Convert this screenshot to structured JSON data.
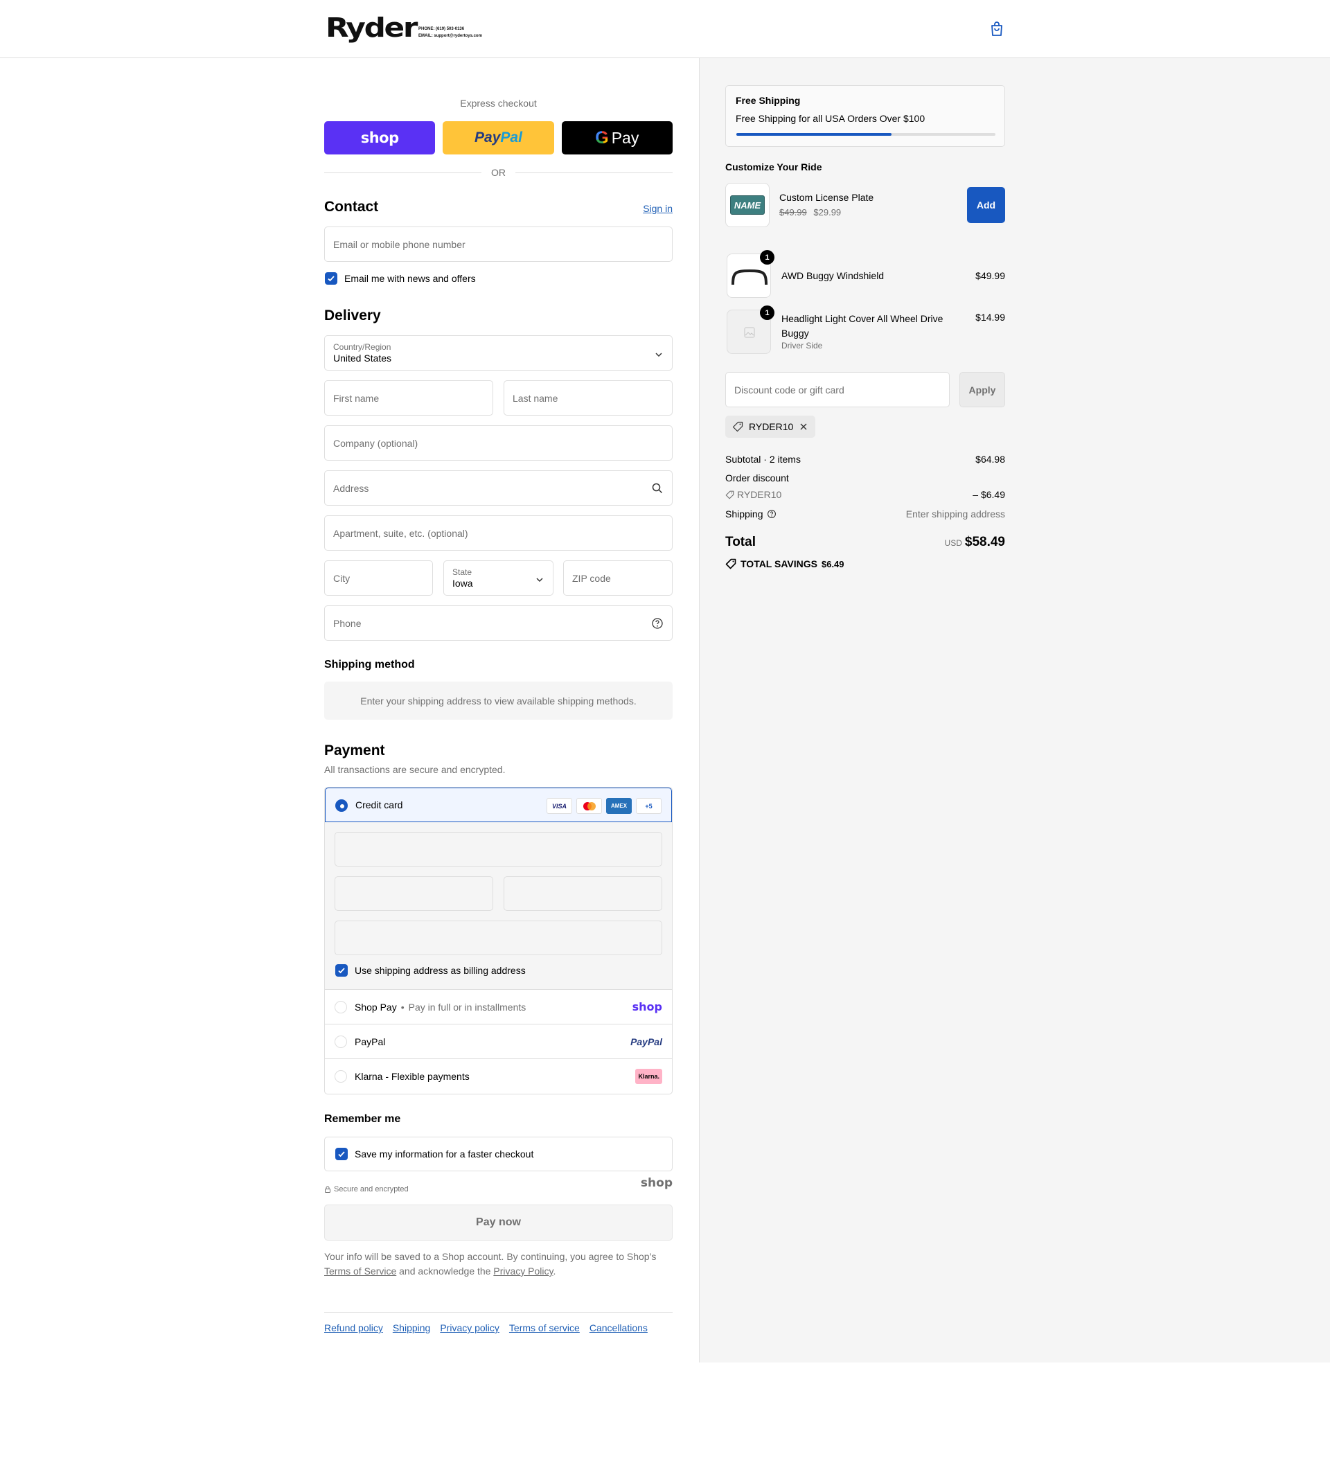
{
  "header": {
    "logo_text": "Ryder",
    "phone": "PHONE: (619) 503-0136",
    "email": "EMAIL: support@rydertoys.com",
    "cart_icon": "shopping-bag-icon"
  },
  "express": {
    "label": "Express checkout",
    "shop": "shop",
    "paypal_a": "Pay",
    "paypal_b": "Pal",
    "gpay_g": "G",
    "gpay_text": "Pay",
    "or": "OR"
  },
  "contact": {
    "title": "Contact",
    "sign_in": "Sign in",
    "email_placeholder": "Email or mobile phone number",
    "news_label": "Email me with news and offers"
  },
  "delivery": {
    "title": "Delivery",
    "country_label": "Country/Region",
    "country_value": "United States",
    "first_name": "First name",
    "last_name": "Last name",
    "company": "Company (optional)",
    "address": "Address",
    "apartment": "Apartment, suite, etc. (optional)",
    "city": "City",
    "state_label": "State",
    "state_value": "Iowa",
    "zip": "ZIP code",
    "phone": "Phone"
  },
  "shipping_method": {
    "title": "Shipping method",
    "message": "Enter your shipping address to view available shipping methods."
  },
  "payment": {
    "title": "Payment",
    "subtitle": "All transactions are secure and encrypted.",
    "credit_card": "Credit card",
    "card_logos": [
      "VISA",
      "",
      "AMEX",
      "+5"
    ],
    "billing_label": "Use shipping address as billing address",
    "shop_pay": "Shop Pay",
    "shop_pay_desc": "Pay in full or in installments",
    "shop_logo": "shop",
    "paypal": "PayPal",
    "paypal_logo": "PayPal",
    "klarna": "Klarna - Flexible payments",
    "klarna_logo": "Klarna."
  },
  "remember": {
    "title": "Remember me",
    "save_label": "Save my information for a faster checkout",
    "secure": "Secure and encrypted",
    "shop_logo": "shop"
  },
  "pay_now": "Pay now",
  "fine_print": {
    "pre": "Your info will be saved to a Shop account. By continuing, you agree to Shop’s",
    "tos": "Terms of Service",
    "mid": "and acknowledge the",
    "privacy": "Privacy Policy",
    "end": "."
  },
  "footer_links": [
    "Refund policy",
    "Shipping",
    "Privacy policy",
    "Terms of service",
    "Cancellations"
  ],
  "summary": {
    "free_shipping_title": "Free Shipping",
    "free_shipping_text": "Free Shipping for all USA Orders Over $100",
    "free_shipping_progress": 0.6,
    "customize_title": "Customize Your Ride",
    "upsell_name": "Custom License Plate",
    "upsell_old_price": "$49.99",
    "upsell_price": "$29.99",
    "upsell_plate_text": "NAME",
    "add_label": "Add",
    "items": [
      {
        "name": "AWD Buggy Windshield",
        "variant": "",
        "qty": "1",
        "price": "$49.99"
      },
      {
        "name": "Headlight Light Cover All Wheel Drive Buggy",
        "variant": "Driver Side",
        "qty": "1",
        "price": "$14.99"
      }
    ],
    "discount_placeholder": "Discount code or gift card",
    "apply_label": "Apply",
    "applied_code": "RYDER10",
    "subtotal_label": "Subtotal · 2 items",
    "subtotal_value": "$64.98",
    "order_discount_label": "Order discount",
    "discount_code": "RYDER10",
    "discount_value": "– $6.49",
    "shipping_label": "Shipping",
    "shipping_value": "Enter shipping address",
    "total_label": "Total",
    "currency": "USD",
    "total_value": "$58.49",
    "savings_label": "TOTAL SAVINGS",
    "savings_value": "$6.49"
  }
}
